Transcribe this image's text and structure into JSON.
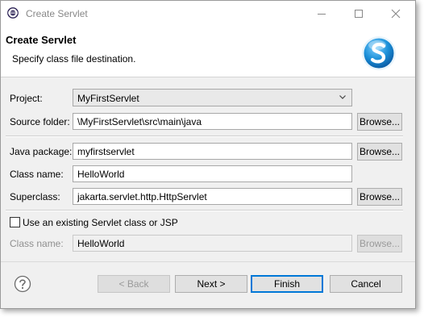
{
  "window": {
    "title": "Create Servlet"
  },
  "banner": {
    "title": "Create Servlet",
    "subtitle": "Specify class file destination."
  },
  "form": {
    "project_label": "Project:",
    "project_value": "MyFirstServlet",
    "source_folder_label": "Source folder:",
    "source_folder_value": "\\MyFirstServlet\\src\\main\\java",
    "java_package_label": "Java package:",
    "java_package_value": "myfirstservlet",
    "class_name_label": "Class name:",
    "class_name_value": "HelloWorld",
    "superclass_label": "Superclass:",
    "superclass_value": "jakarta.servlet.http.HttpServlet",
    "browse_label": "Browse...",
    "existing_checkbox_label": "Use an existing Servlet class or JSP",
    "existing_checked": false,
    "existing_class_name_label": "Class name:",
    "existing_class_name_value": "HelloWorld"
  },
  "footer": {
    "back_label": "< Back",
    "next_label": "Next >",
    "finish_label": "Finish",
    "cancel_label": "Cancel"
  },
  "colors": {
    "default_button_border": "#0078d7",
    "logo_blue": "#1a8fd8"
  }
}
